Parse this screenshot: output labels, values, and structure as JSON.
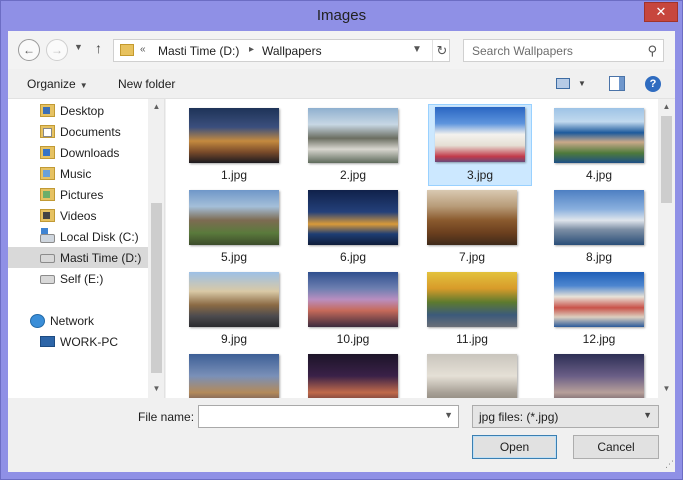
{
  "window": {
    "title": "Images",
    "close_glyph": "✕"
  },
  "navigation": {
    "back_icon": "back-arrow-icon",
    "forward_icon": "forward-arrow-icon",
    "recent_icon": "chevron-down-icon",
    "up_icon": "up-arrow-icon"
  },
  "address": {
    "overflow": "«",
    "crumbs": [
      "Masti Time (D:)",
      "Wallpapers"
    ],
    "separator": "▸"
  },
  "search": {
    "placeholder": "Search Wallpapers"
  },
  "toolbar": {
    "organize": "Organize",
    "new_folder": "New folder"
  },
  "nav_pane": {
    "items": [
      {
        "label": "Desktop",
        "icon": "desktop-folder-icon"
      },
      {
        "label": "Documents",
        "icon": "documents-folder-icon"
      },
      {
        "label": "Downloads",
        "icon": "downloads-folder-icon"
      },
      {
        "label": "Music",
        "icon": "music-folder-icon"
      },
      {
        "label": "Pictures",
        "icon": "pictures-folder-icon"
      },
      {
        "label": "Videos",
        "icon": "videos-folder-icon"
      },
      {
        "label": "Local Disk (C:)",
        "icon": "system-drive-icon"
      },
      {
        "label": "Masti Time (D:)",
        "icon": "drive-icon",
        "selected": true
      },
      {
        "label": "Self (E:)",
        "icon": "drive-icon"
      },
      {
        "label": "Network",
        "icon": "network-icon"
      },
      {
        "label": "WORK-PC",
        "icon": "computer-icon"
      }
    ]
  },
  "files": [
    {
      "name": "1.jpg"
    },
    {
      "name": "2.jpg"
    },
    {
      "name": "3.jpg",
      "selected": true
    },
    {
      "name": "4.jpg"
    },
    {
      "name": "5.jpg"
    },
    {
      "name": "6.jpg"
    },
    {
      "name": "7.jpg"
    },
    {
      "name": "8.jpg"
    },
    {
      "name": "9.jpg"
    },
    {
      "name": "10.jpg"
    },
    {
      "name": "11.jpg"
    },
    {
      "name": "12.jpg"
    },
    {
      "name": ""
    },
    {
      "name": ""
    },
    {
      "name": ""
    },
    {
      "name": ""
    }
  ],
  "bottom": {
    "file_name_label": "File name:",
    "file_name_value": "",
    "file_type": "jpg files: (*.jpg)",
    "open": "Open",
    "cancel": "Cancel"
  },
  "colors": {
    "accent": "#3c7fb1",
    "selection": "#cce8ff",
    "window_frame": "#8f90e6",
    "close": "#c7463d"
  }
}
